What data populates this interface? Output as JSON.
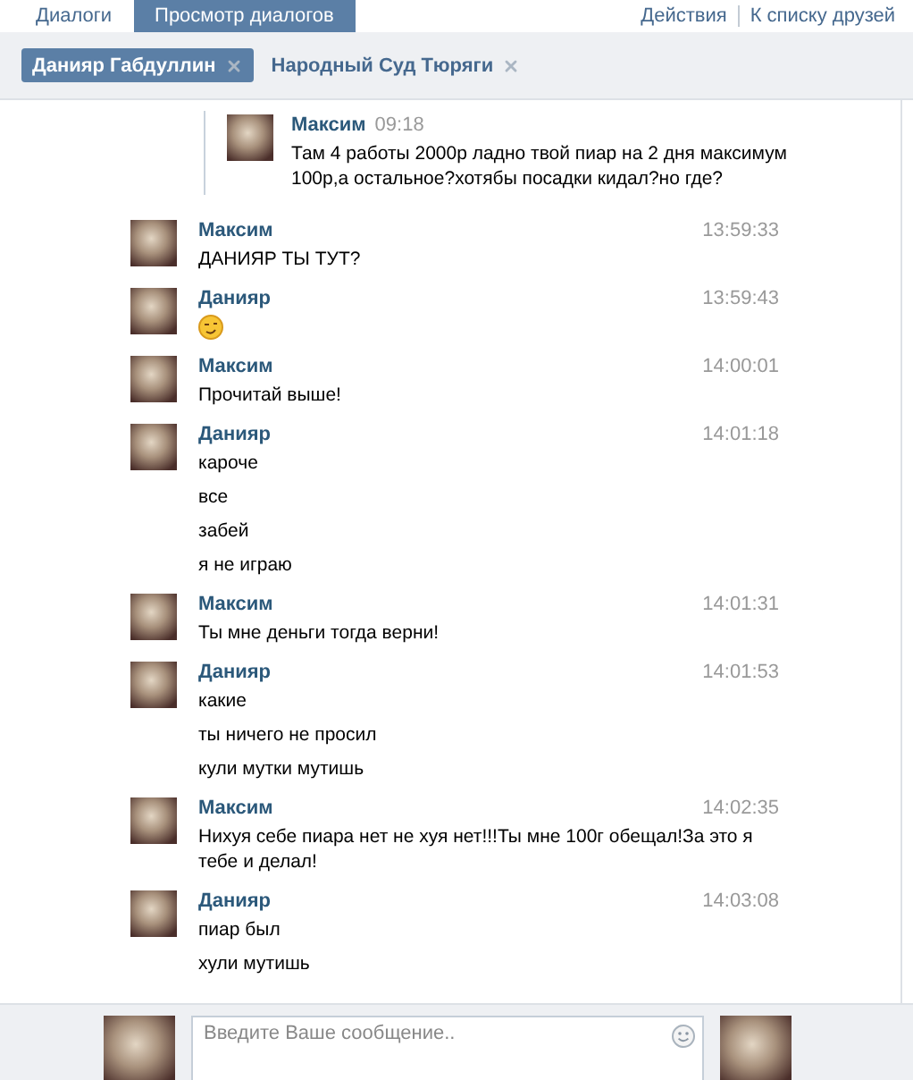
{
  "top_tabs": [
    {
      "label": "Диалоги",
      "selected": false
    },
    {
      "label": "Просмотр диалогов",
      "selected": true
    }
  ],
  "top_links": [
    "Действия",
    "К списку друзей"
  ],
  "dialog_tabs": [
    {
      "label": "Данияр Габдуллин",
      "selected": true
    },
    {
      "label": "Народный Суд Тюряги",
      "selected": false
    }
  ],
  "forwarded": {
    "author": "Максим",
    "time": "09:18",
    "text": "Там 4 работы 2000р ладно твой пиар на 2 дня максимум 100р,а остальное?хотябы посадки кидал?но где?"
  },
  "messages": [
    {
      "author": "Максим",
      "time": "13:59:33",
      "lines": [
        {
          "kind": "text",
          "text": "ДАНИЯР ТЫ ТУТ?"
        }
      ]
    },
    {
      "author": "Данияр",
      "time": "13:59:43",
      "lines": [
        {
          "kind": "emoji"
        }
      ]
    },
    {
      "author": "Максим",
      "time": "14:00:01",
      "lines": [
        {
          "kind": "text",
          "text": "Прочитай выше!"
        }
      ]
    },
    {
      "author": "Данияр",
      "time": "14:01:18",
      "lines": [
        {
          "kind": "text",
          "text": "кароче"
        },
        {
          "kind": "text",
          "text": "все"
        },
        {
          "kind": "text",
          "text": "забей"
        },
        {
          "kind": "text",
          "text": "я не играю"
        }
      ]
    },
    {
      "author": "Максим",
      "time": "14:01:31",
      "lines": [
        {
          "kind": "text",
          "text": "Ты мне деньги тогда верни!"
        }
      ]
    },
    {
      "author": "Данияр",
      "time": "14:01:53",
      "lines": [
        {
          "kind": "text",
          "text": "какие"
        },
        {
          "kind": "text",
          "text": "ты ничего не просил"
        },
        {
          "kind": "text",
          "text": "кули мутки мутишь"
        }
      ]
    },
    {
      "author": "Максим",
      "time": "14:02:35",
      "lines": [
        {
          "kind": "text",
          "text": "Нихуя себе пиара нет не хуя нет!!!Ты мне 100г обещал!За это я тебе и делал!"
        }
      ]
    },
    {
      "author": "Данияр",
      "time": "14:03:08",
      "lines": [
        {
          "kind": "text",
          "text": "пиар был"
        },
        {
          "kind": "text",
          "text": "хули мутишь"
        }
      ]
    }
  ],
  "composer": {
    "placeholder": "Введите Ваше сообщение.."
  }
}
